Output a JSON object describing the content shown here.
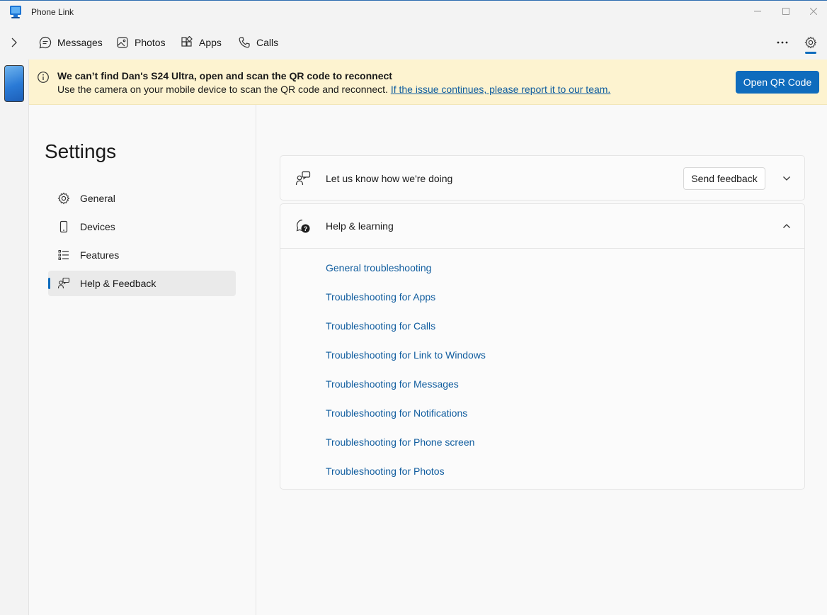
{
  "window": {
    "title": "Phone Link",
    "controls": [
      "minimize-icon",
      "maximize-icon",
      "close-icon"
    ]
  },
  "nav": {
    "tabs": [
      {
        "label": "Messages",
        "icon": "message-icon"
      },
      {
        "label": "Photos",
        "icon": "photo-icon"
      },
      {
        "label": "Apps",
        "icon": "apps-icon"
      },
      {
        "label": "Calls",
        "icon": "phone-icon"
      }
    ],
    "more_icon": "more-icon",
    "settings_icon": "gear-icon"
  },
  "banner": {
    "title": "We can’t find Dan's S24 Ultra, open and scan the QR code to reconnect",
    "description": "Use the camera on your mobile device to scan the QR code and reconnect.",
    "link": "If the issue continues, please report it to our team.",
    "button": "Open QR Code",
    "background": "#fdf3d0"
  },
  "settings": {
    "title": "Settings",
    "items": [
      {
        "label": "General",
        "icon": "gear-icon"
      },
      {
        "label": "Devices",
        "icon": "phone-icon"
      },
      {
        "label": "Features",
        "icon": "list-icon"
      },
      {
        "label": "Help & Feedback",
        "icon": "feedback-icon",
        "selected": true
      }
    ]
  },
  "feedback_card": {
    "label": "Let us know how we're doing",
    "button": "Send feedback",
    "expanded": false
  },
  "help_card": {
    "label": "Help & learning",
    "expanded": true,
    "links": [
      "General troubleshooting",
      "Troubleshooting for Apps",
      "Troubleshooting for Calls",
      "Troubleshooting for Link to Windows",
      "Troubleshooting for Messages",
      "Troubleshooting for Notifications",
      "Troubleshooting for Phone screen",
      "Troubleshooting for Photos"
    ]
  },
  "colors": {
    "accent": "#0f6cbd",
    "link": "#0f5c9e"
  }
}
